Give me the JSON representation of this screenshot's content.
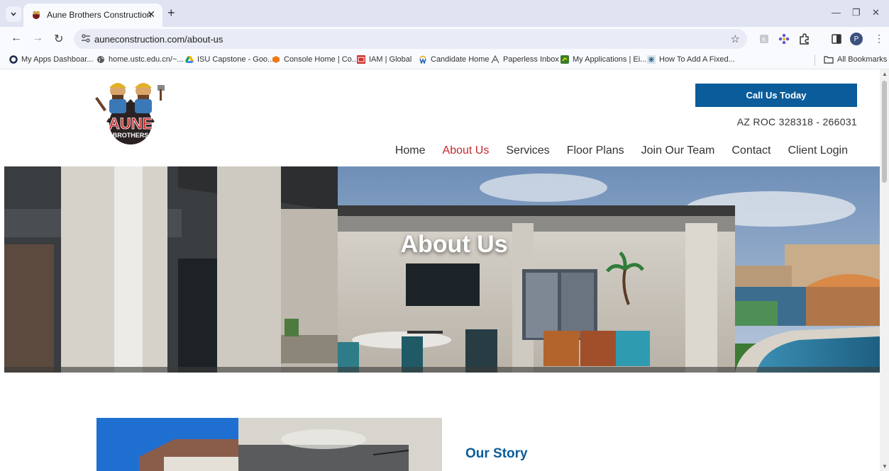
{
  "browser": {
    "tab_title": "Aune Brothers Construction",
    "url": "auneconstruction.com/about-us",
    "profile_initial": "P",
    "bookmarks": [
      "My Apps Dashboar...",
      "home.ustc.edu.cn/~...",
      "ISU Capstone - Goo...",
      "Console Home | Co...",
      "IAM | Global",
      "Candidate Home",
      "Paperless Inbox",
      "My Applications | Ei...",
      "How To Add A Fixed..."
    ],
    "all_bookmarks": "All Bookmarks"
  },
  "header": {
    "logo_text": "AUNE",
    "logo_subtext": "BROTHERS",
    "call_button": "Call Us Today",
    "license": "AZ ROC 328318 - 266031",
    "nav": [
      "Home",
      "About Us",
      "Services",
      "Floor Plans",
      "Join Our Team",
      "Contact",
      "Client Login"
    ],
    "active_nav": "About Us"
  },
  "hero": {
    "title": "About Us"
  },
  "story": {
    "heading": "Our Story"
  },
  "colors": {
    "brand_blue": "#0a5c9a",
    "active_red": "#c8282d"
  }
}
